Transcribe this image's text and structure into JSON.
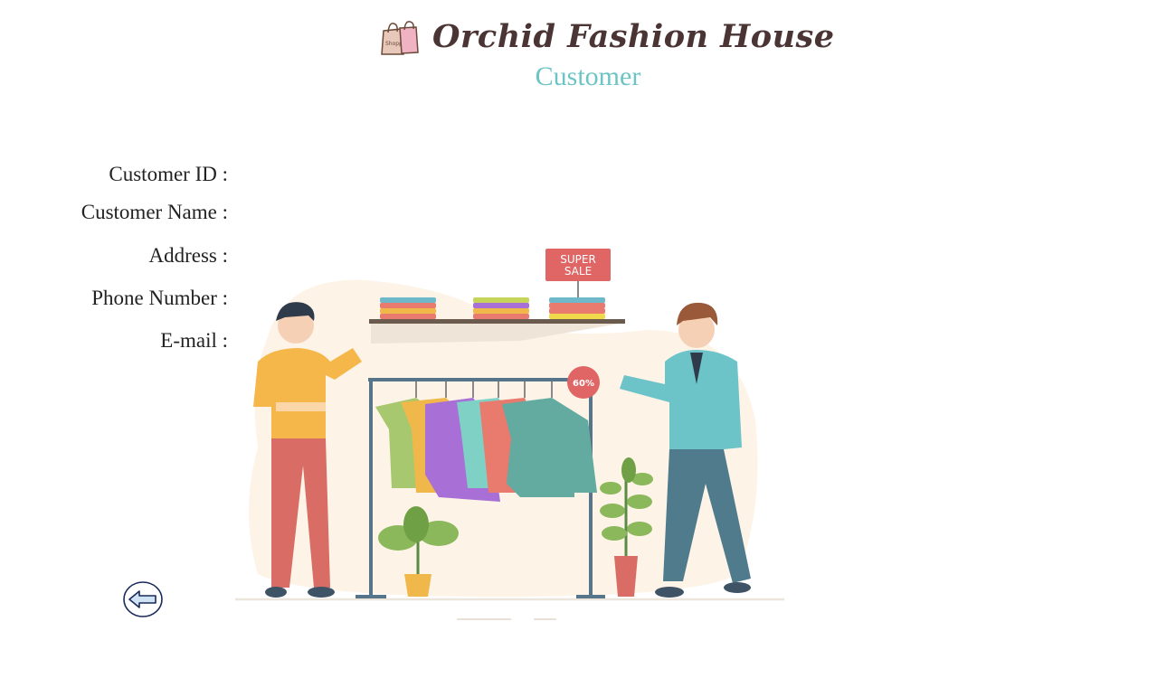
{
  "header": {
    "title": "Orchid Fashion House",
    "subtitle": "Customer"
  },
  "form": {
    "fields": [
      {
        "label": "Customer ID :",
        "value": ""
      },
      {
        "label": "Customer Name :",
        "value": ""
      },
      {
        "label": "Address :",
        "value": ""
      },
      {
        "label": "Phone Number :",
        "value": ""
      },
      {
        "label": "E-mail :",
        "value": ""
      }
    ]
  },
  "illustration": {
    "sign_text_line1": "SUPER",
    "sign_text_line2": "SALE",
    "badge_text": "60%",
    "bag_text": "Shopping"
  },
  "back_button": {
    "icon": "arrow-left-icon"
  },
  "colors": {
    "title": "#4a3434",
    "subtitle": "#6cc4c4",
    "sign": "#e06666"
  }
}
